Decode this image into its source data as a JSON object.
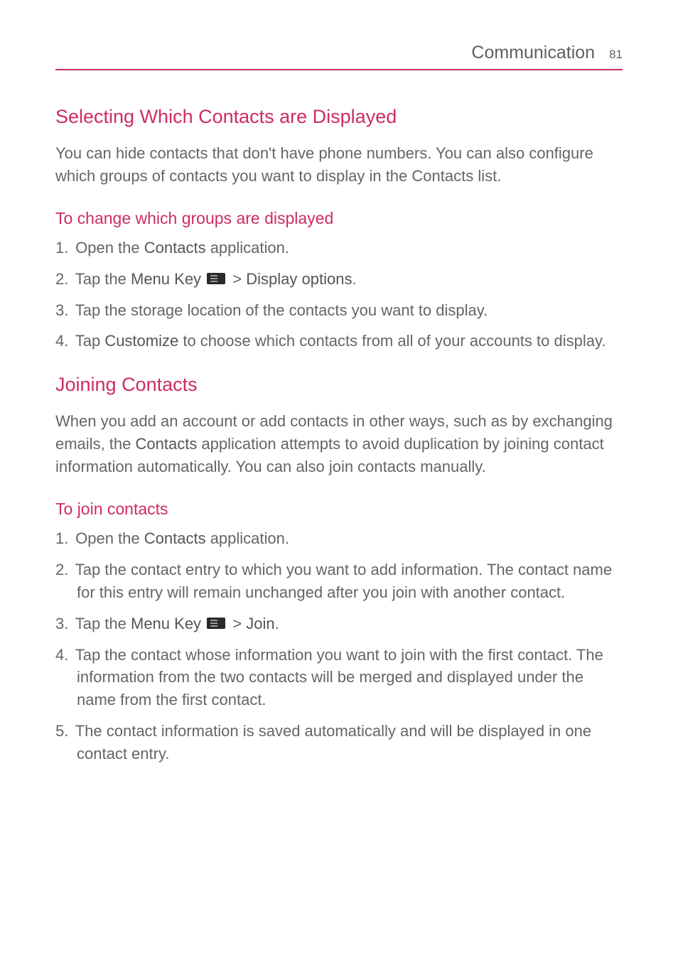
{
  "header": {
    "title": "Communication",
    "page_number": "81"
  },
  "section1": {
    "heading": "Selecting Which Contacts are Displayed",
    "intro": "You can hide contacts that don't have phone numbers. You can also configure which groups of contacts you want to display in the Contacts list.",
    "sub_heading": "To change which groups are displayed",
    "steps": {
      "s1_num": "1.",
      "s1_a": "  Open the ",
      "s1_bold": "Contacts",
      "s1_b": " application.",
      "s2_num": "2.",
      "s2_a": " Tap the ",
      "s2_bold1": "Menu Key",
      "s2_gt": " > ",
      "s2_bold2": "Display options",
      "s2_b": ".",
      "s3_num": "3.",
      "s3_a": " Tap the storage location of the contacts you want to display.",
      "s4_num": "4.",
      "s4_a": " Tap ",
      "s4_bold": "Customize",
      "s4_b": " to choose which contacts from all of your accounts to display."
    }
  },
  "section2": {
    "heading": "Joining Contacts",
    "intro_a": "When you add an account or add contacts in other ways, such as by exchanging emails, the ",
    "intro_bold": "Contacts",
    "intro_b": " application attempts to avoid duplication by joining contact information automatically. You can also join contacts manually.",
    "sub_heading": "To join contacts",
    "steps": {
      "s1_num": "1.",
      "s1_a": "  Open the ",
      "s1_bold": "Contacts",
      "s1_b": " application.",
      "s2_num": "2.",
      "s2_a": " Tap the contact entry to which you want to add information. The contact name for this entry will remain unchanged after you join with another contact.",
      "s3_num": "3.",
      "s3_a": " Tap the ",
      "s3_bold1": "Menu Key",
      "s3_gt": " > ",
      "s3_bold2": "Join",
      "s3_b": ".",
      "s4_num": "4.",
      "s4_a": " Tap the contact whose information you want to join with the first contact. The information from the two contacts will be merged and displayed under the name from the first contact.",
      "s5_num": "5.",
      "s5_a": " The contact information is saved automatically and will be displayed in one contact entry."
    }
  }
}
